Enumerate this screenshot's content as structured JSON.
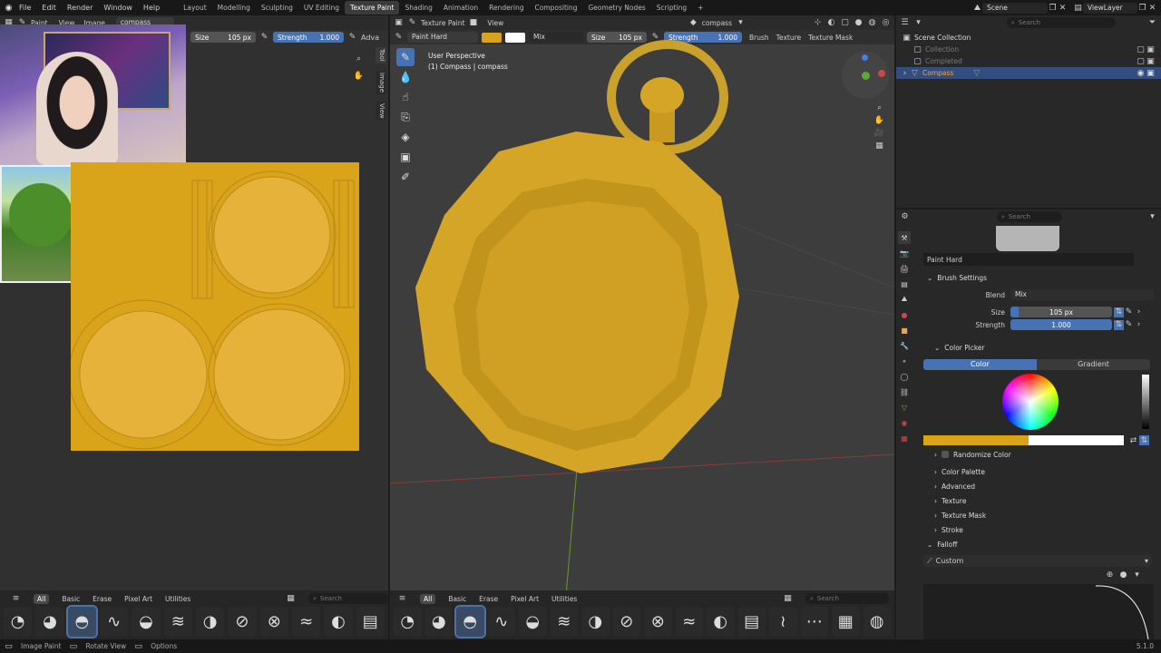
{
  "menubar": {
    "items": [
      "File",
      "Edit",
      "Render",
      "Window",
      "Help"
    ],
    "workspaces": [
      "Layout",
      "Modelling",
      "Sculpting",
      "UV Editing",
      "Texture Paint",
      "Shading",
      "Animation",
      "Rendering",
      "Compositing",
      "Geometry Nodes",
      "Scripting"
    ],
    "active_workspace": "Texture Paint",
    "add_tab": "+",
    "scene": "Scene",
    "view_layer": "ViewLayer"
  },
  "image_editor": {
    "mode": "Paint",
    "view": "View",
    "image": "Image",
    "image_name": "compass",
    "size_label": "Size",
    "size_value": "105 px",
    "strength_label": "Strength",
    "strength_value": "1.000",
    "adva": "Adva",
    "side_tabs": [
      "Tool",
      "Image",
      "View"
    ]
  },
  "viewport": {
    "mode": "Texture Paint",
    "view": "View",
    "object": "compass",
    "brush": "Paint Hard",
    "blend": "Mix",
    "size_label": "Size",
    "size_value": "105 px",
    "strength_label": "Strength",
    "strength_value": "1.000",
    "brush_menu": "Brush",
    "texture_menu": "Texture",
    "texture_mask_menu": "Texture Mask",
    "overlay_title": "User Perspective",
    "overlay_subtitle": "(1) Compass | compass"
  },
  "asset_shelf": {
    "tabs": [
      "All",
      "Basic",
      "Erase",
      "Pixel Art",
      "Utilities"
    ],
    "active_tab": "All",
    "search_placeholder": "Search",
    "left_brushes": [
      "draw",
      "blur",
      "paint-hard",
      "smear",
      "soft",
      "airbrush",
      "clone",
      "erase-hard",
      "erase-soft",
      "fill",
      "mask",
      "pixel"
    ],
    "right_brushes": [
      "draw",
      "blur",
      "paint-hard",
      "smear",
      "soft",
      "airbrush",
      "clone",
      "erase-hard",
      "erase-soft",
      "fill",
      "mask",
      "pixel",
      "smear-2",
      "noise",
      "texture",
      "gradient"
    ]
  },
  "outliner": {
    "search_placeholder": "Search",
    "root": "Scene Collection",
    "items": [
      {
        "label": "Collection",
        "dim": true
      },
      {
        "label": "Completed",
        "dim": true
      },
      {
        "label": "Compass",
        "dim": false,
        "selected": true
      }
    ]
  },
  "properties": {
    "search_placeholder": "Search",
    "brush_name": "Paint Hard",
    "brush_settings": "Brush Settings",
    "blend_label": "Blend",
    "blend_value": "Mix",
    "size_label": "Size",
    "size_value": "105 px",
    "strength_label": "Strength",
    "strength_value": "1.000",
    "color_picker": "Color Picker",
    "color_tab": "Color",
    "gradient_tab": "Gradient",
    "randomize_color": "Randomize Color",
    "sections": [
      "Color Palette",
      "Advanced",
      "Texture",
      "Texture Mask",
      "Stroke"
    ],
    "falloff": "Falloff",
    "falloff_preset": "Custom",
    "primary_color": "#d9a41a",
    "secondary_color": "#ffffff"
  },
  "statusbar": {
    "items": [
      "Image Paint",
      "Rotate View",
      "Options"
    ],
    "version": "5.1.0"
  },
  "colors": {
    "accent": "#4772b3",
    "paint": "#d9a41a",
    "model": "#d4a526"
  }
}
